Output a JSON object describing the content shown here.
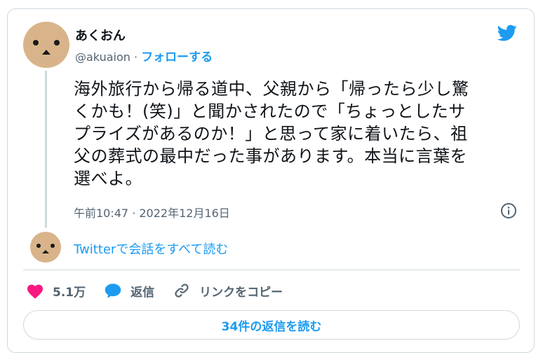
{
  "author": {
    "display_name": "あくおん",
    "handle": "@akuaion",
    "separator": "·",
    "follow_label": "フォローする"
  },
  "tweet": {
    "lines": [
      "海外旅行から帰る道中、父親から「帰ったら少し驚",
      "くかも！(笑)」と聞かされたので「ちょっとしたサ",
      "プライズがあるのか！」と思って家に着いたら、祖",
      "父の葬式の最中だった事があります。本当に言葉を",
      "選べよ。"
    ],
    "timestamp": "午前10:47 · 2022年12月16日"
  },
  "conversation": {
    "read_label": "Twitterで会話をすべて読む"
  },
  "actions": {
    "like_count": "5.1万",
    "reply_label": "返信",
    "copy_link_label": "リンクをコピー"
  },
  "replies_button": {
    "label": "34件の返信を読む"
  },
  "icons": {
    "brand": "twitter-bird-icon",
    "info": "info-icon",
    "like": "heart-icon",
    "reply": "speech-bubble-icon",
    "link": "link-icon"
  },
  "colors": {
    "accent": "#1d9bf0",
    "like": "#f91880",
    "text": "#0f1419",
    "muted": "#536471",
    "border": "#cfd9de",
    "avatar": "#d9b48a"
  }
}
